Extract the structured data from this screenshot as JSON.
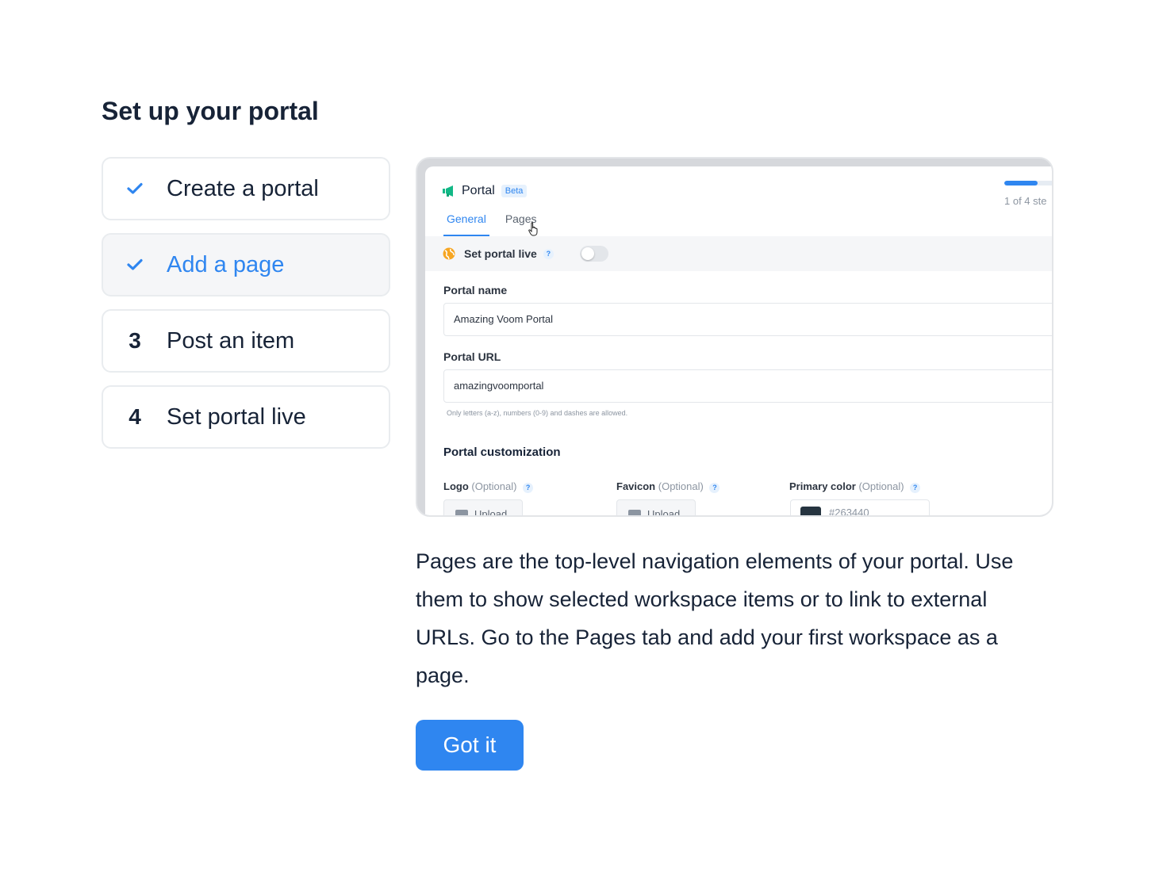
{
  "title": "Set up your portal",
  "steps": [
    {
      "marker": "check",
      "label": "Create a portal",
      "done": true,
      "active": false
    },
    {
      "marker": "check",
      "label": "Add a page",
      "done": true,
      "active": true
    },
    {
      "marker": "3",
      "label": "Post an item",
      "done": false,
      "active": false
    },
    {
      "marker": "4",
      "label": "Set portal live",
      "done": false,
      "active": false
    }
  ],
  "preview": {
    "app_title": "Portal",
    "badge": "Beta",
    "progress_text": "1 of 4 ste",
    "progress_fraction": 0.25,
    "tabs": [
      "General",
      "Pages"
    ],
    "selected_tab": "General",
    "live_label": "Set portal live",
    "help": "?",
    "portal_name_label": "Portal name",
    "portal_name_value": "Amazing Voom Portal",
    "portal_url_label": "Portal URL",
    "portal_url_value": "amazingvoomportal",
    "url_hint": "Only letters (a-z), numbers (0-9) and dashes are allowed.",
    "customization_title": "Portal customization",
    "logo_label": "Logo",
    "favicon_label": "Favicon",
    "primary_color_label": "Primary color",
    "optional": "(Optional)",
    "upload_label": "Upload",
    "primary_color_value": "#263440",
    "primary_color_hex_text": "#263440"
  },
  "description": "Pages are the top-level navigation elements of your portal. Use them to show selected workspace items or to link to external URLs. Go to the Pages tab and add your first workspace as a page.",
  "button_label": "Got it",
  "colors": {
    "accent": "#2f86f0",
    "text": "#172337",
    "active_bg": "#f5f6f8"
  }
}
